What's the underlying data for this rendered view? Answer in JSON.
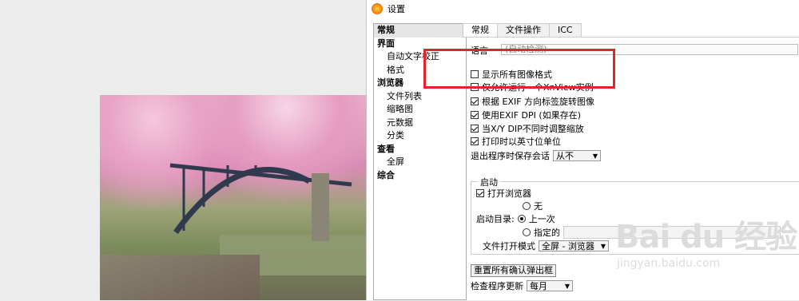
{
  "window": {
    "title": "设置"
  },
  "tree": [
    {
      "label": "常规",
      "bold": true,
      "child": false,
      "selected": true
    },
    {
      "label": "界面",
      "bold": true,
      "child": false
    },
    {
      "label": "自动文字校正",
      "bold": false,
      "child": true
    },
    {
      "label": "格式",
      "bold": false,
      "child": true
    },
    {
      "label": "浏览器",
      "bold": true,
      "child": false
    },
    {
      "label": "文件列表",
      "bold": false,
      "child": true
    },
    {
      "label": "缩略图",
      "bold": false,
      "child": true
    },
    {
      "label": "元数据",
      "bold": false,
      "child": true
    },
    {
      "label": "分类",
      "bold": false,
      "child": true
    },
    {
      "label": "查看",
      "bold": true,
      "child": false
    },
    {
      "label": "全屏",
      "bold": false,
      "child": true
    },
    {
      "label": "综合",
      "bold": true,
      "child": false
    }
  ],
  "tabs": [
    "常规",
    "文件操作",
    "ICC"
  ],
  "general": {
    "language_label": "语言",
    "language_value": "(自动检测)",
    "checkboxes": [
      {
        "label": "显示所有图像格式",
        "checked": false
      },
      {
        "label": "仅允许运行一个XnView实例",
        "checked": false
      },
      {
        "label": "根据 EXIF 方向标签旋转图像",
        "checked": true
      },
      {
        "label": "使用EXIF DPI (如果存在)",
        "checked": true
      },
      {
        "label": "当X/Y DIP不同时调整缩放",
        "checked": true
      },
      {
        "label": "打印时以英寸位单位",
        "checked": true
      }
    ],
    "save_session_label": "退出程序时保存会话",
    "save_session_value": "从不",
    "startup": {
      "group_title": "启动",
      "open_browser_label": "打开浏览器",
      "open_browser_checked": true,
      "dir_label": "启动目录:",
      "options": [
        {
          "label": "无",
          "checked": false
        },
        {
          "label": "上一次",
          "checked": true
        },
        {
          "label": "指定的",
          "checked": false
        }
      ],
      "file_open_mode_label": "文件打开模式",
      "file_open_mode_value": "全屏 - 浏览器"
    },
    "reset_button": "重置所有确认弹出框",
    "check_updates_label": "检查程序更新",
    "check_updates_value": "每月"
  },
  "watermark": {
    "logo": "Bai du 经验",
    "url": "jingyan.baidu.com"
  },
  "highlight_color": "#e1252a"
}
